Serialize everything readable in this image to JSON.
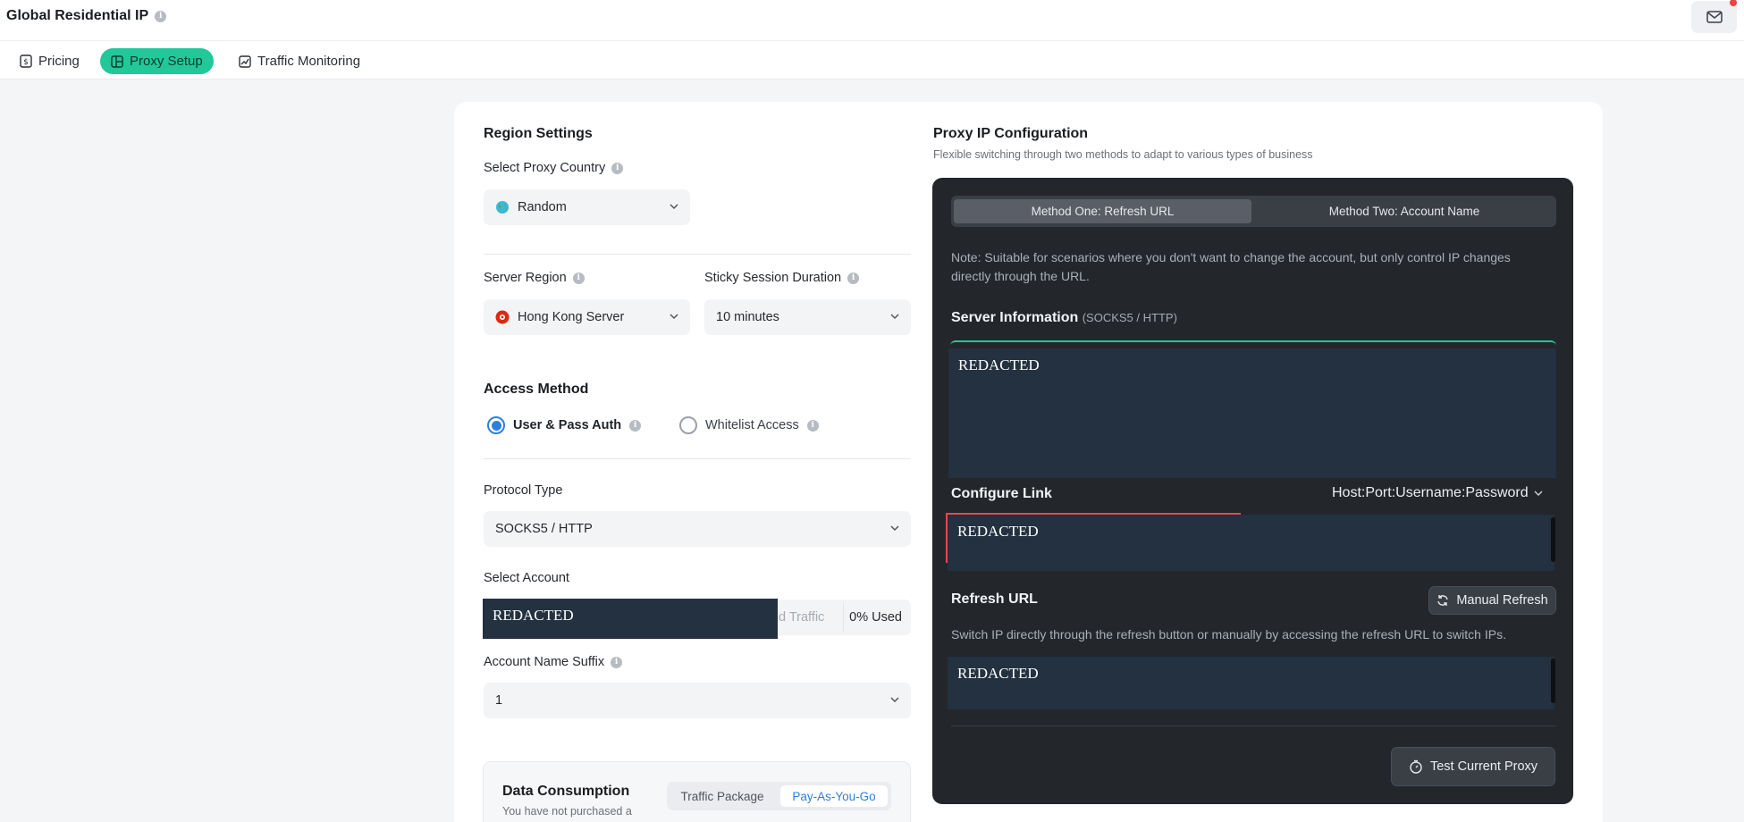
{
  "header": {
    "title": "Global Residential IP"
  },
  "nav": {
    "tabs": [
      {
        "label": "Pricing",
        "icon": "dollar-doc-icon"
      },
      {
        "label": "Proxy Setup",
        "icon": "layout-icon"
      },
      {
        "label": "Traffic Monitoring",
        "icon": "chart-icon"
      }
    ],
    "active": "Proxy Setup"
  },
  "region": {
    "title": "Region Settings",
    "country_label": "Select Proxy Country",
    "country_value": "Random",
    "server_label": "Server Region",
    "server_value": "Hong Kong Server",
    "sticky_label": "Sticky Session Duration",
    "sticky_value": "10 minutes"
  },
  "access": {
    "title": "Access Method",
    "options": [
      "User & Pass Auth",
      "Whitelist Access"
    ],
    "selected": "User & Pass Auth"
  },
  "protocol": {
    "label": "Protocol Type",
    "value": "SOCKS5 / HTTP"
  },
  "account": {
    "label": "Select Account",
    "redacted": "REDACTED",
    "traffic_partial": "d Traffic",
    "used": "0% Used",
    "suffix_label": "Account Name Suffix",
    "suffix_value": "1"
  },
  "consumption": {
    "title": "Data Consumption",
    "note": "You have not purchased a",
    "tabs": [
      "Traffic Package",
      "Pay-As-You-Go"
    ],
    "active": "Pay-As-You-Go"
  },
  "proxy_config": {
    "title": "Proxy IP Configuration",
    "subtitle": "Flexible switching through two methods to adapt to various types of business",
    "methods": [
      "Method One: Refresh URL",
      "Method Two: Account Name"
    ],
    "active_method": "Method One: Refresh URL",
    "note": "Note: Suitable for scenarios where you don't want to change the account, but only control IP changes directly through the URL.",
    "server_info_title": "Server Information",
    "server_info_sub": "(SOCKS5 / HTTP)",
    "server_info_value": "REDACTED",
    "configure_link_title": "Configure Link",
    "link_format": "Host:Port:Username:Password",
    "configure_link_value": "REDACTED",
    "refresh_title": "Refresh URL",
    "manual_refresh": "Manual Refresh",
    "refresh_desc": "Switch IP directly through the refresh button or manually by accessing the refresh URL to switch IPs.",
    "refresh_value": "REDACTED",
    "test_button": "Test Current Proxy"
  },
  "colors": {
    "accent_green": "#22c79a",
    "radio_blue": "#2f7fd9",
    "dark_panel": "#23262b",
    "notification_red": "#ef4444"
  }
}
